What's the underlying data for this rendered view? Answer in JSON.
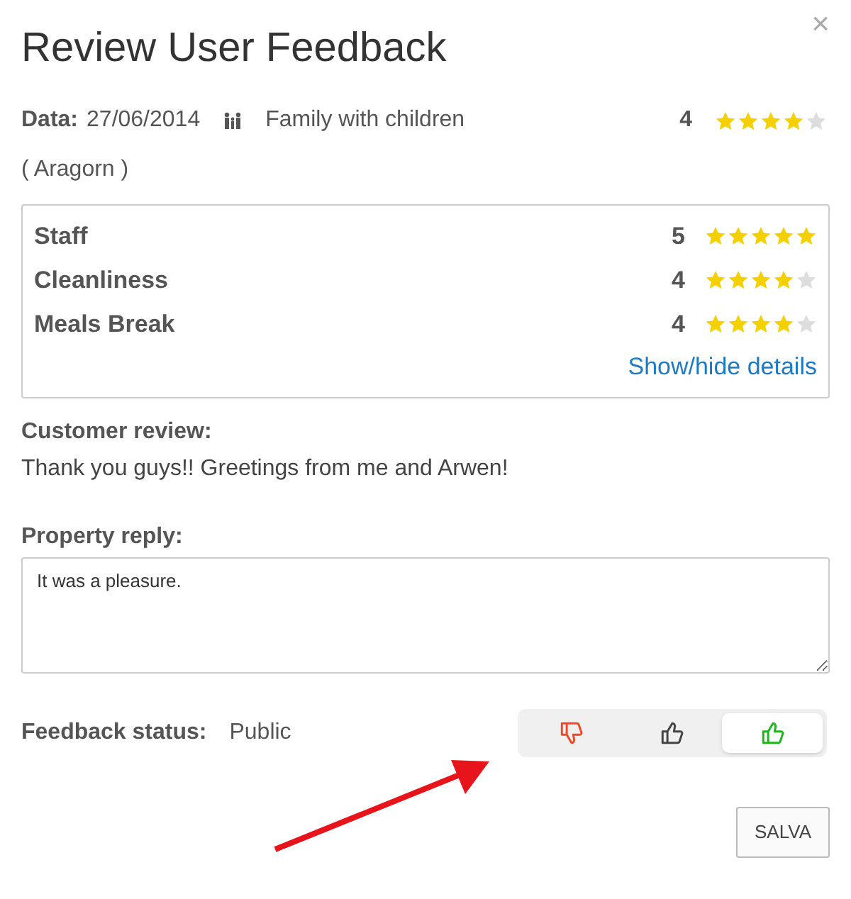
{
  "dialog": {
    "title": "Review User Feedback",
    "close": "×"
  },
  "summary": {
    "date_label": "Data:",
    "date": "27/06/2014",
    "traveller_type": "Family with children",
    "score": "4",
    "stars": 4,
    "guest": "( Aragorn )"
  },
  "ratings": [
    {
      "label": "Staff",
      "score": "5",
      "stars": 5
    },
    {
      "label": "Cleanliness",
      "score": "4",
      "stars": 4
    },
    {
      "label": "Meals Break",
      "score": "4",
      "stars": 4
    }
  ],
  "details_link": "Show/hide details",
  "customer_review": {
    "label": "Customer review:",
    "text": "Thank you guys!! Greetings from me and Arwen!"
  },
  "property_reply": {
    "label": "Property reply:",
    "value": "It was a pleasure."
  },
  "feedback_status": {
    "label": "Feedback status:",
    "value": "Public",
    "options": [
      {
        "kind": "negative",
        "selected": false
      },
      {
        "kind": "neutral",
        "selected": false
      },
      {
        "kind": "positive",
        "selected": true
      }
    ]
  },
  "buttons": [
    "SALVA"
  ]
}
